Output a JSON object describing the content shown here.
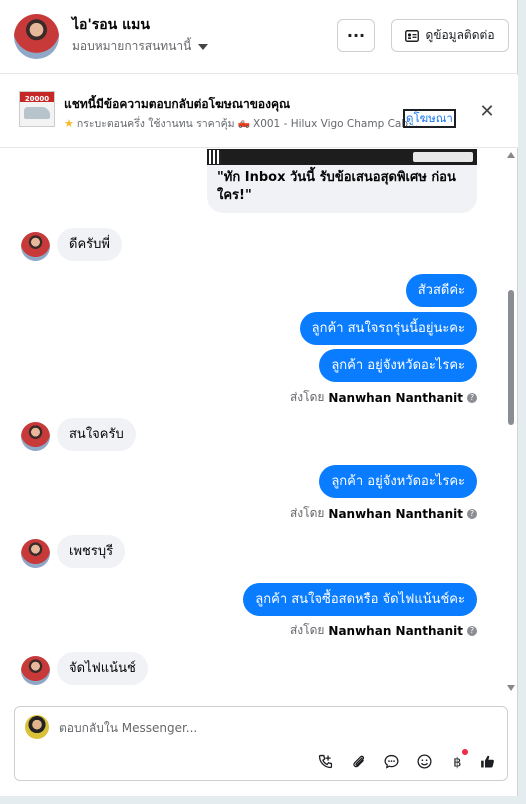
{
  "header": {
    "contact_name": "ไอ'รอน แมน",
    "assign_label": "มอบหมายการสนทนานี้",
    "more_label": "···",
    "contact_info_label": "ดูข้อมูลติดต่อ"
  },
  "ad_banner": {
    "title": "แชทนี้มีข้อความตอบกลับต่อโฆษณาของคุณ",
    "meta_text": "กระบะตอนครึ่ง ใช้งานทน ราคาคุ้ม",
    "meta_code": "X001 - Hilux Vigo Champ Cab...",
    "thumb_text": "20000",
    "link_label": "ดูโฆษณา"
  },
  "chat": {
    "ad_card_text": "\"ทัก Inbox วันนี้ รับข้อเสนอสุดพิเศษ ก่อนใคร!\"",
    "messages": [
      {
        "dir": "in",
        "text": "ดีครับพี่"
      },
      {
        "dir": "out",
        "text": "สัวสดีค่ะ"
      },
      {
        "dir": "out",
        "text": "ลูกค้า สนใจรถรุ่นนี้อยู่นะคะ"
      },
      {
        "dir": "out",
        "text": "ลูกค้า อยู่จังหวัดอะไรคะ"
      },
      {
        "dir": "in",
        "text": "สนใจครับ"
      },
      {
        "dir": "out",
        "text": "ลูกค้า อยู่จังหวัดอะไรคะ"
      },
      {
        "dir": "in",
        "text": "เพชรบุรี"
      },
      {
        "dir": "out",
        "text": "ลูกค้า สนใจซื้อสดหรือ จัดไฟแน้นช์คะ"
      },
      {
        "dir": "in",
        "text": "จัดไฟแน้นช์"
      }
    ],
    "sent_by_prefix": "ส่งโดย",
    "sent_by_name": "Nanwhan Nanthanit"
  },
  "composer": {
    "placeholder": "ตอบกลับใน Messenger...",
    "tools": [
      "call-add-icon",
      "attachment-icon",
      "chat-bubble-icon",
      "emoji-icon",
      "baht-icon",
      "thumbs-up-icon"
    ]
  },
  "colors": {
    "outgoing_bubble": "#0a7cff",
    "incoming_bubble": "#f0f2f5",
    "link": "#1877f2"
  }
}
